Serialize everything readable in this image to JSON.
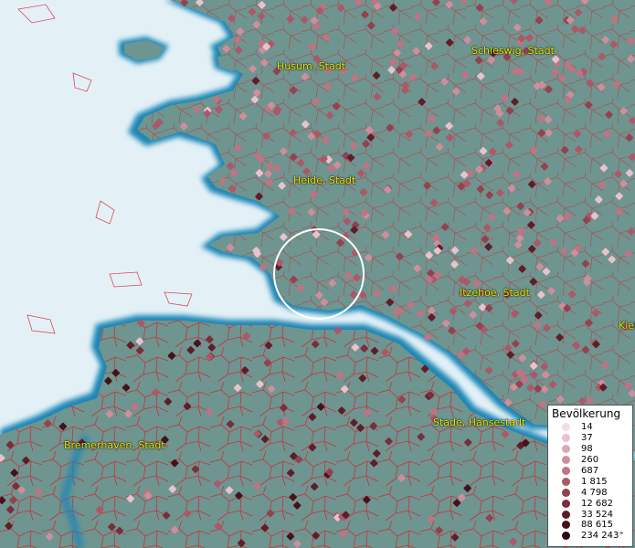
{
  "map": {
    "labels": [
      {
        "id": "husum",
        "text": "Husum, Stadt"
      },
      {
        "id": "schleswig",
        "text": "Schleswig, Stadt"
      },
      {
        "id": "heide",
        "text": "Heide, Stadt"
      },
      {
        "id": "itzehoe",
        "text": "Itzehoe, Stadt"
      },
      {
        "id": "stade",
        "text": "Stade, Hansestadt"
      },
      {
        "id": "bremerhaven",
        "text": "Bremerhaven, Stadt"
      },
      {
        "id": "kiel",
        "text": "Kiel"
      }
    ],
    "colors": {
      "sea": "#e3f1f7",
      "coast": "#1f86b5",
      "land": "#6e9590",
      "borders": "#d8202a",
      "label": "#e6e600"
    }
  },
  "legend": {
    "title": "Bevölkerung",
    "items": [
      {
        "label": "14",
        "color": "#f3dde3"
      },
      {
        "label": "37",
        "color": "#e9c2cc"
      },
      {
        "label": "98",
        "color": "#dca8b4"
      },
      {
        "label": "260",
        "color": "#cf8e9c"
      },
      {
        "label": "687",
        "color": "#c07383"
      },
      {
        "label": "1 815",
        "color": "#ad5868"
      },
      {
        "label": "4 798",
        "color": "#944150"
      },
      {
        "label": "12 682",
        "color": "#7a2d3b"
      },
      {
        "label": "33 524",
        "color": "#5f1d29"
      },
      {
        "label": "88 615",
        "color": "#45111b"
      },
      {
        "label": "234 243⁺",
        "color": "#2c080e"
      }
    ]
  }
}
